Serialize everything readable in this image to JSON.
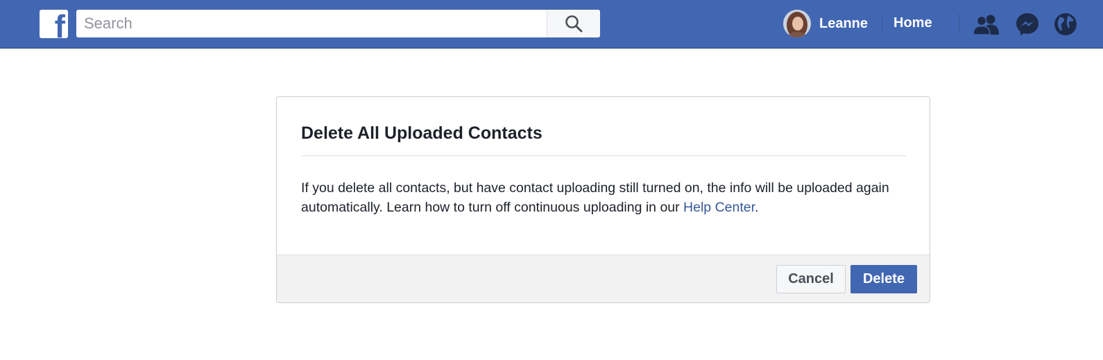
{
  "topbar": {
    "logo_letter": "f",
    "search": {
      "placeholder": "Search",
      "value": ""
    },
    "user": {
      "name": "Leanne"
    },
    "home_label": "Home",
    "icons": [
      "friend-requests-icon",
      "messenger-icon",
      "notifications-globe-icon"
    ]
  },
  "dialog": {
    "title": "Delete All Uploaded Contacts",
    "body_text": "If you delete all contacts, but have contact uploading still turned on, the info will be uploaded again automatically. Learn how to turn off continuous uploading in our ",
    "help_link": "Help Center",
    "body_end": ".",
    "cancel_label": "Cancel",
    "delete_label": "Delete"
  },
  "colors": {
    "brand_blue": "#4267b2",
    "link_blue": "#365899",
    "text_dark": "#1d2129",
    "footer_gray": "#f2f2f2"
  }
}
